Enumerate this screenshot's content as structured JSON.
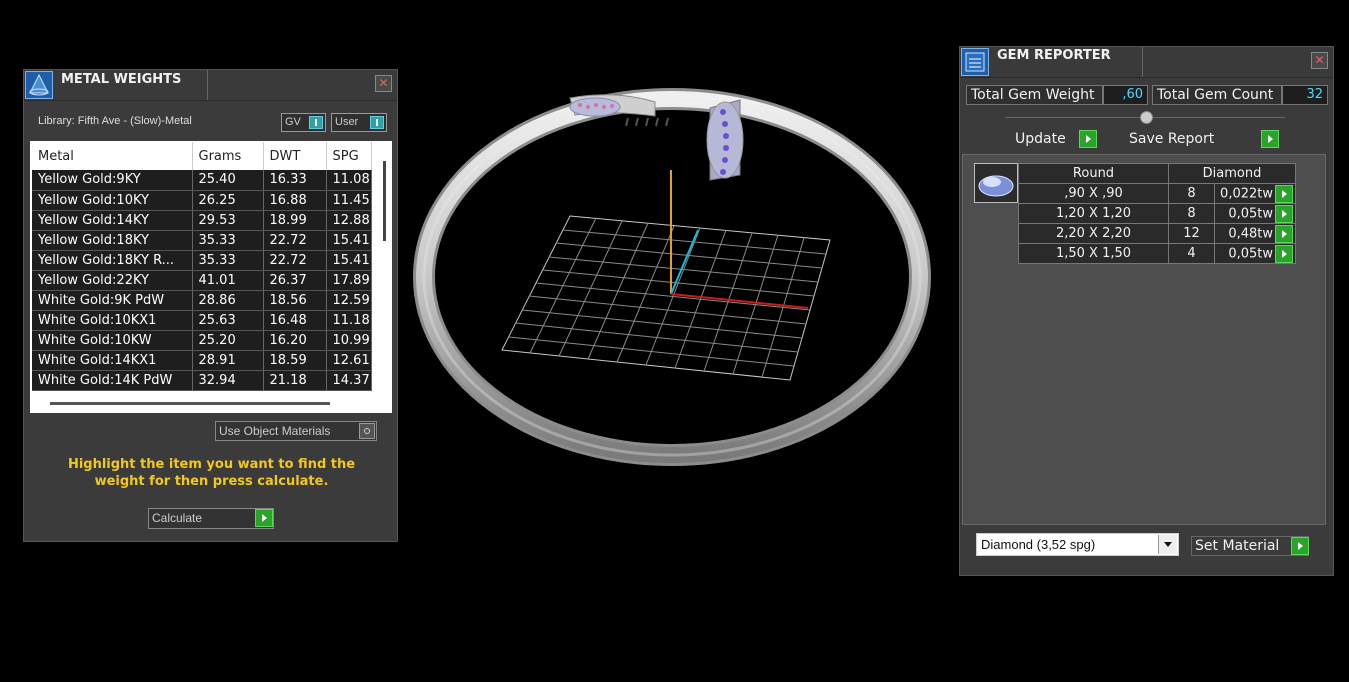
{
  "metal_weights": {
    "title": "METAL WEIGHTS",
    "close_label": "✕",
    "library_label": "Library: Fifth Ave - (Slow)-Metal",
    "toggle_gv": "GV",
    "toggle_user": "User",
    "columns": [
      "Metal",
      "Grams",
      "DWT",
      "SPG"
    ],
    "rows": [
      [
        "Yellow Gold:9KY",
        "25.40",
        "16.33",
        "11.08"
      ],
      [
        "Yellow Gold:10KY",
        "26.25",
        "16.88",
        "11.45"
      ],
      [
        "Yellow Gold:14KY",
        "29.53",
        "18.99",
        "12.88"
      ],
      [
        "Yellow Gold:18KY",
        "35.33",
        "22.72",
        "15.41"
      ],
      [
        "Yellow Gold:18KY R...",
        "35.33",
        "22.72",
        "15.41"
      ],
      [
        "Yellow Gold:22KY",
        "41.01",
        "26.37",
        "17.89"
      ],
      [
        "White Gold:9K PdW",
        "28.86",
        "18.56",
        "12.59"
      ],
      [
        "White Gold:10KX1",
        "25.63",
        "16.48",
        "11.18"
      ],
      [
        "White Gold:10KW",
        "25.20",
        "16.20",
        "10.99"
      ],
      [
        "White Gold:14KX1",
        "28.91",
        "18.59",
        "12.61"
      ],
      [
        "White Gold:14K PdW",
        "32.94",
        "21.18",
        "14.37"
      ]
    ],
    "use_object_materials": "Use Object Materials",
    "hint": "Highlight the item you want to find the weight for then press calculate.",
    "calculate_label": "Calculate"
  },
  "gem_reporter": {
    "title": "GEM REPORTER",
    "close_label": "✕",
    "total_gem_weight_label": "Total Gem Weight",
    "total_gem_weight_value": ",60",
    "total_gem_count_label": "Total Gem Count",
    "total_gem_count_value": "32",
    "update_label": "Update",
    "save_report_label": "Save Report",
    "gem_shape": "Round",
    "gem_material": "Diamond",
    "gems": [
      {
        "size": ",90 X ,90",
        "count": "8",
        "weight": "0,022tw"
      },
      {
        "size": "1,20 X 1,20",
        "count": "8",
        "weight": "0,05tw"
      },
      {
        "size": "2,20 X 2,20",
        "count": "12",
        "weight": "0,48tw"
      },
      {
        "size": "1,50 X 1,50",
        "count": "4",
        "weight": "0,05tw"
      }
    ],
    "material_select": "Diamond     (3,52 spg)",
    "set_material_label": "Set Material"
  },
  "colors": {
    "accent_green": "#28a528",
    "accent_cyan": "#4fd8ff",
    "hint_yellow": "#f2c81e",
    "axis_x": "#d01818",
    "axis_y": "#19b8d8",
    "axis_z": "#e0a030"
  }
}
